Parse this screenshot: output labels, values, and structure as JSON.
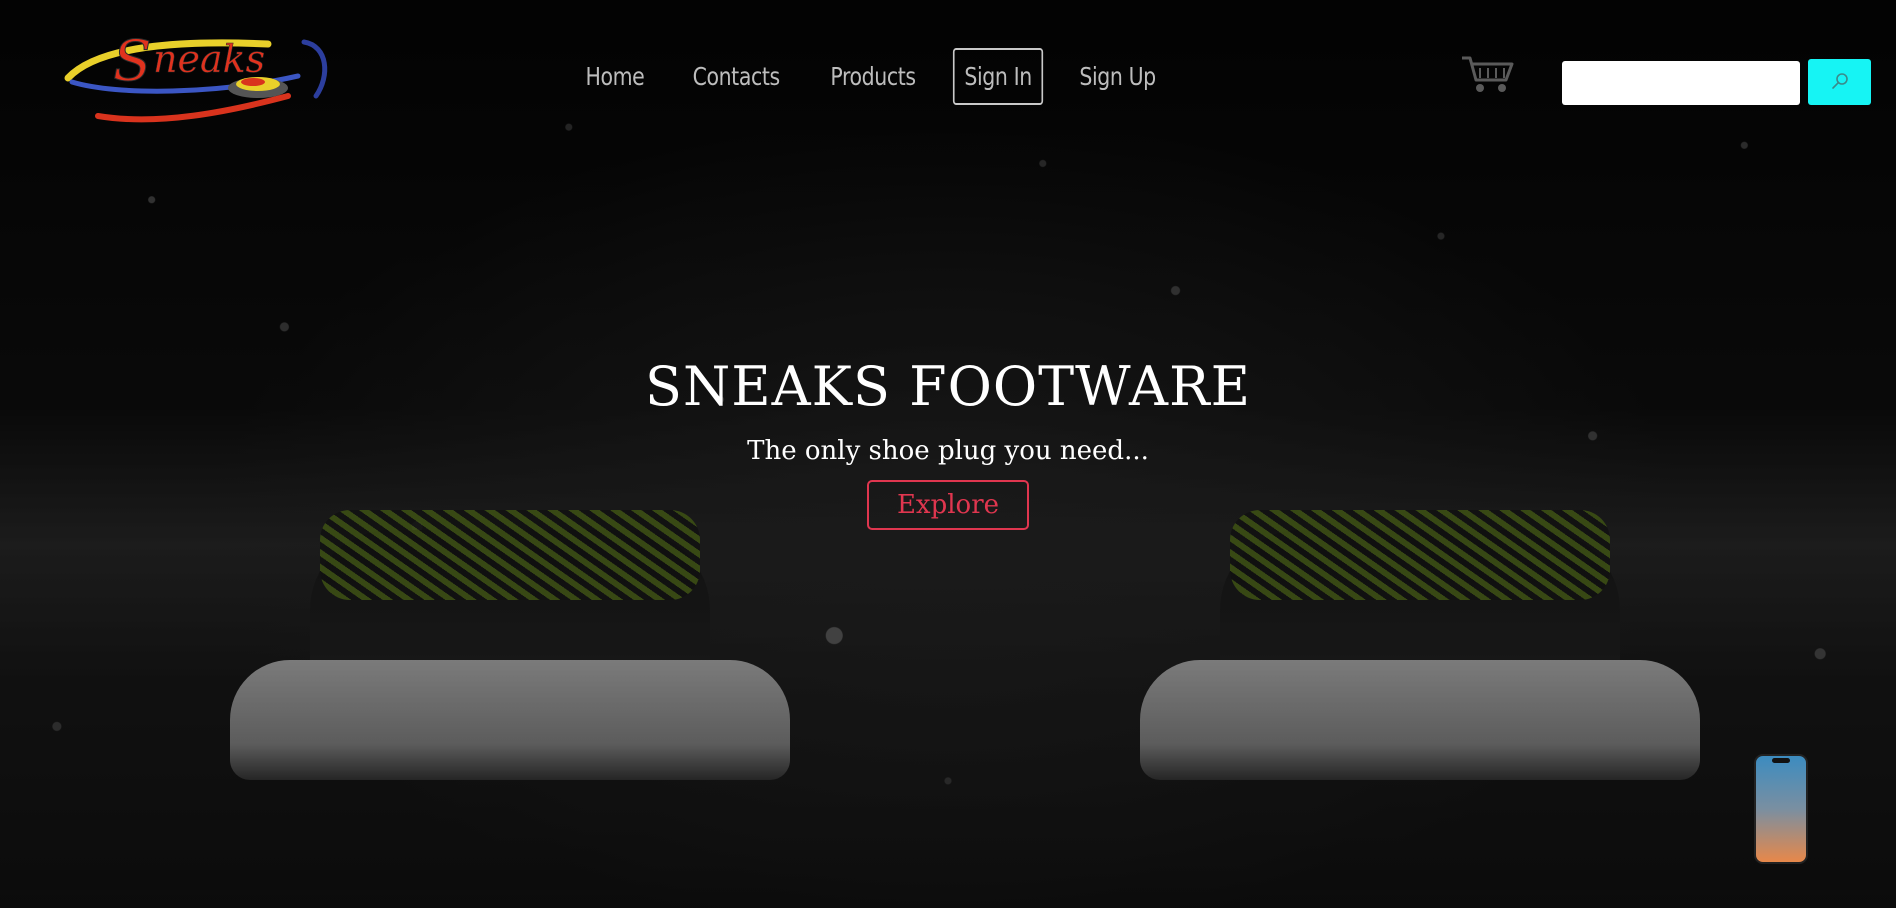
{
  "header": {
    "logo_text": "Sneaks",
    "nav_links": [
      "Home",
      "Contacts",
      "Products",
      "Sign In",
      "Sign Up"
    ],
    "active_link": "Sign In",
    "search": {
      "placeholder": "",
      "value": ""
    }
  },
  "hero": {
    "title": "SNEAKS FOOTWARE",
    "subtitle": "The only shoe plug you need...",
    "cta_label": "Explore"
  },
  "icons": {
    "cart": "cart-icon",
    "search": "search-icon",
    "phone": "phone-icon"
  },
  "colors": {
    "accent_cyan": "#16f4f4",
    "cta_red": "#e0364f",
    "nav_text": "#bdbdbd"
  }
}
